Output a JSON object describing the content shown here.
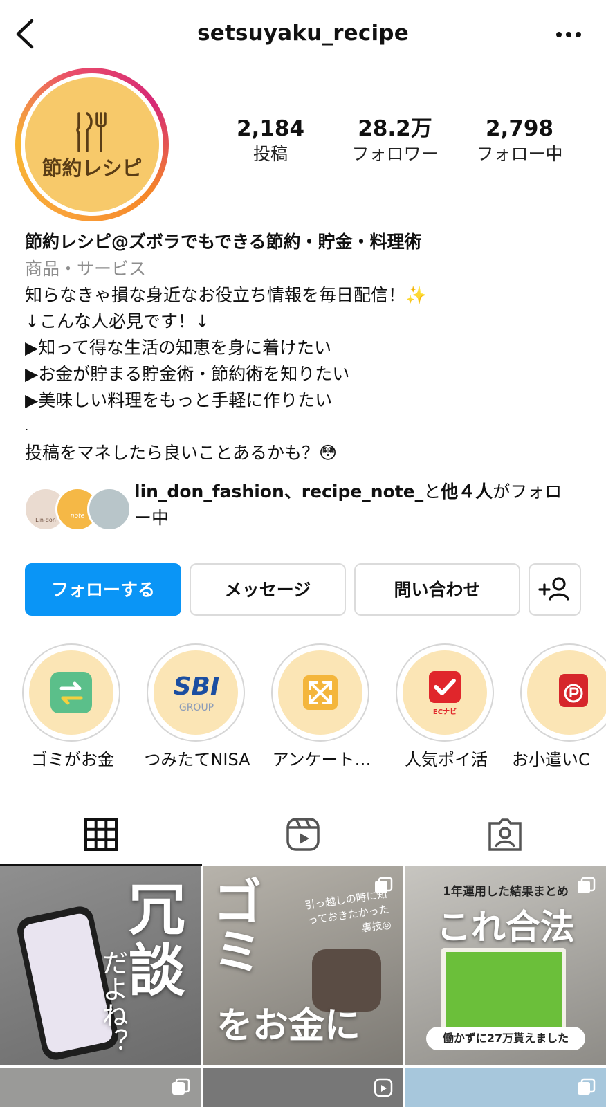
{
  "header": {
    "username": "setsuyaku_recipe"
  },
  "avatar": {
    "text": "節約レシピ"
  },
  "stats": [
    {
      "value": "2,184",
      "label": "投稿"
    },
    {
      "value": "28.2万",
      "label": "フォロワー"
    },
    {
      "value": "2,798",
      "label": "フォロー中"
    }
  ],
  "bio": {
    "name": "節約レシピ@ズボラでもできる節約・貯金・料理術",
    "category": "商品・サービス",
    "lines": [
      "知らなきゃ損な身近なお役立ち情報を毎日配信！✨",
      "↓こんな人必見です！↓",
      "▶知って得な生活の知恵を身に着けたい",
      "▶お金が貯まる貯金術・節約術を知りたい",
      "▶美味しい料理をもっと手軽に作りたい",
      ".",
      "投稿をマネしたら良いことあるかも？😳"
    ]
  },
  "followed_by": {
    "names": "lin_don_fashion、recipe_note_",
    "connector": "と",
    "others": "他４人",
    "suffix": "がフォロー中",
    "avatar1_text": "Lin-don",
    "avatar2_text": "note"
  },
  "buttons": {
    "follow": "フォローする",
    "message": "メッセージ",
    "contact": "問い合わせ"
  },
  "highlights": [
    {
      "label": "ゴミがお金",
      "icon": "exchange-icon",
      "color": "#5bbf8a"
    },
    {
      "label": "つみたてNISA",
      "icon": "sbi-group-logo",
      "color": "#1b4ea1"
    },
    {
      "label": "アンケート…",
      "icon": "shrink-arrows-icon",
      "color": "#f4b63c"
    },
    {
      "label": "人気ポイ活",
      "icon": "checkmark-icon",
      "color": "#e0262b"
    },
    {
      "label": "お小遣いC",
      "icon": "points-p-icon",
      "color": "#d6262b"
    }
  ],
  "highlight_logo_text": {
    "sbi": "SBI",
    "sbi_sub": "GROUP",
    "ecnavi": "ECナビ"
  },
  "tabs": [
    {
      "name": "grid-icon",
      "active": true
    },
    {
      "name": "reels-icon",
      "active": false
    },
    {
      "name": "tagged-icon",
      "active": false
    }
  ],
  "posts": [
    {
      "big": "冗談",
      "sub": "だよね？"
    },
    {
      "big": "ゴミ",
      "small": "引っ越しの時に知っておきたかった裏技◎",
      "bottom": "をお金に"
    },
    {
      "top": "1年運用した結果まとめ",
      "big": "これ合法",
      "bottom": "働かずに27万貰えました"
    }
  ]
}
